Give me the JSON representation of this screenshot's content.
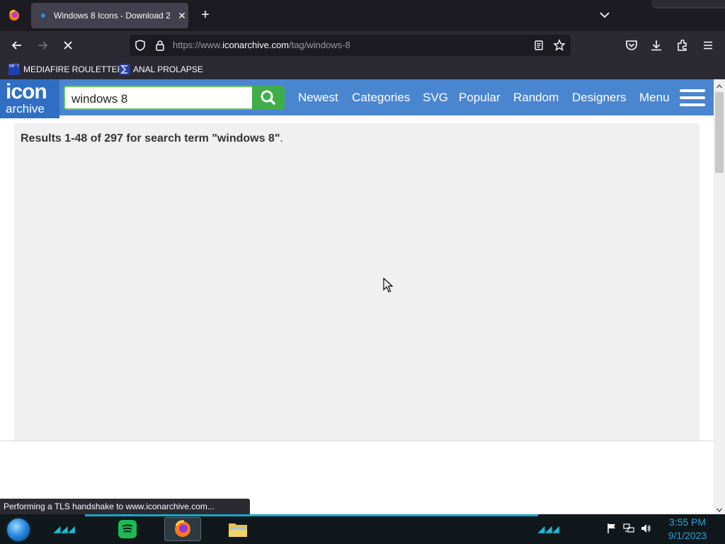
{
  "browser": {
    "tab": {
      "title": "Windows 8 Icons - Download 2",
      "close_glyph": "✕"
    },
    "new_tab_glyph": "+",
    "url": {
      "prefix": "https://www.",
      "host": "iconarchive.com",
      "path": "/tag/windows-8"
    },
    "bookmarks": [
      {
        "label": "MEDIAFIRE ROULETTER",
        "icon_text": "MF T"
      },
      {
        "label": "ANAL PROLAPSE"
      }
    ],
    "status_text": "Performing a TLS handshake to www.iconarchive.com..."
  },
  "site": {
    "logo": {
      "top": "icon",
      "bottom": "archive"
    },
    "search": {
      "value": "windows 8"
    },
    "nav": [
      {
        "label": "Newest"
      },
      {
        "label": "Categories"
      },
      {
        "label": "SVG"
      },
      {
        "label": "Popular"
      },
      {
        "label": "Random"
      },
      {
        "label": "Designers"
      },
      {
        "label": "Menu"
      }
    ],
    "results": {
      "text": "Results 1-48 of 297 for search term \"windows 8\"",
      "period": "."
    },
    "colors": {
      "header": "#4a85d0",
      "logo_bg": "#2f6ec3",
      "search_button": "#3fae49"
    }
  },
  "taskbar": {
    "clock": {
      "time": "3:55 PM",
      "date": "9/1/2023"
    },
    "apps": [
      {
        "icon": "spotify-icon"
      },
      {
        "icon": "firefox-icon"
      },
      {
        "icon": "file-explorer-icon"
      }
    ],
    "tray": [
      "flag-icon",
      "network-icon",
      "speaker-icon"
    ]
  }
}
